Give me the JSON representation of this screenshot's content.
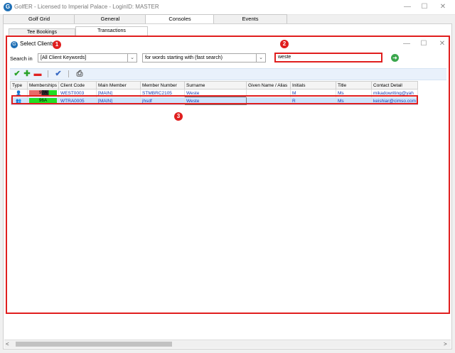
{
  "app": {
    "title": "GolfER - Licensed to Imperial Palace - LoginID: MASTER",
    "logo_glyph": "G",
    "window_buttons": [
      "—",
      "☐",
      "✕"
    ]
  },
  "tabs": [
    "Golf Grid",
    "General",
    "Consoles",
    "Events"
  ],
  "active_tab": "Consoles",
  "subtabs": [
    "Tee Bookings",
    "Transactions"
  ],
  "dialog": {
    "title": "Select Clients",
    "logo_glyph": "G",
    "window_buttons": [
      "—",
      "☐",
      "✕"
    ],
    "search_in_label": "Search in",
    "search_in_value": "[All Client Keywords]",
    "mode_value": "for words starting with (fast search)",
    "search_value": "weste",
    "go_glyph": "➜"
  },
  "badges": [
    "1",
    "2",
    "3"
  ],
  "toolbar": {
    "check": "✔",
    "add": "✚",
    "remove": "▬",
    "check_all": "✔",
    "print": "⎙"
  },
  "grid": {
    "columns": [
      "Type",
      "Memberships",
      "Client Code",
      "Main Member",
      "Member Number",
      "Surname",
      "Given Name / Alias",
      "Initials",
      "Title",
      "Contact Detail"
    ],
    "rows": [
      {
        "type_icon": "👤",
        "membership": "97A",
        "client_code": "WEST0003",
        "main_member": "[MAIN]",
        "member_number": "STMBRC2105",
        "surname": "Weste",
        "given_name": "",
        "initials": "M",
        "title": "Ms",
        "contact": "mikadowriting@yah"
      },
      {
        "type_icon": "👥",
        "membership": "96A",
        "client_code": "WTRA0005",
        "main_member": "[MAIN]",
        "member_number": "jhsdf",
        "surname": "Weste",
        "given_name": "",
        "initials": "R",
        "title": "Ms",
        "contact": "keishiar@cimso.com"
      }
    ]
  },
  "colors": {
    "highlight": "#e01e1e",
    "selected_row": "#cfe3fb",
    "membership_green": "#22dd22",
    "membership_red": "#e86a6a"
  }
}
